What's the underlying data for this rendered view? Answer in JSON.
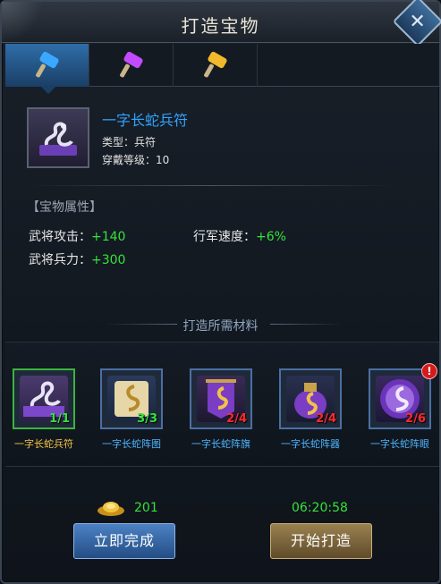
{
  "window": {
    "title": "打造宝物",
    "close_label": "✕"
  },
  "tabs": [
    {
      "name": "tab-blue-hammer",
      "color": "#3aa8ff"
    },
    {
      "name": "tab-purple-hammer",
      "color": "#c24bff"
    },
    {
      "name": "tab-gold-hammer",
      "color": "#f1b92b"
    }
  ],
  "item": {
    "name": "一字长蛇兵符",
    "type_label": "类型：兵符",
    "level_label": "穿戴等级：10"
  },
  "attributes": {
    "section_title": "【宝物属性】",
    "list": [
      {
        "label": "武将攻击：",
        "value": "+140"
      },
      {
        "label": "行军速度：",
        "value": "+6%"
      },
      {
        "label": "武将兵力：",
        "value": "+300"
      }
    ]
  },
  "materials": {
    "title": "打造所需材料",
    "items": [
      {
        "name": "一字长蛇兵符",
        "count": "1/1"
      },
      {
        "name": "一字长蛇阵图",
        "count": "3/3"
      },
      {
        "name": "一字长蛇阵旗",
        "count": "2/4"
      },
      {
        "name": "一字长蛇阵器",
        "count": "2/4"
      },
      {
        "name": "一字长蛇阵眼",
        "count": "2/6"
      }
    ],
    "alert_mark": "!"
  },
  "footer": {
    "gold": "201",
    "timer": "06:20:58",
    "finish_label": "立即完成",
    "start_label": "开始打造"
  }
}
